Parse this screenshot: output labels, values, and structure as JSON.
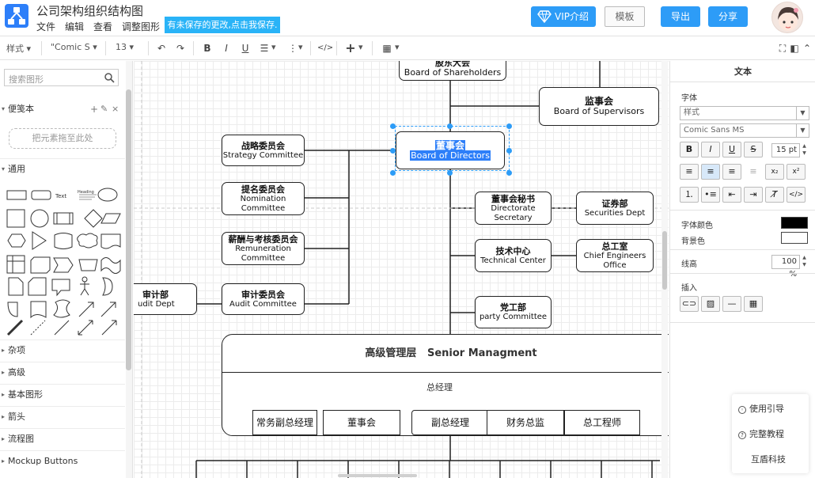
{
  "header": {
    "title": "公司架构组织结构图",
    "menu": [
      "文件",
      "编辑",
      "查看",
      "调整图形"
    ],
    "save_banner": "有未保存的更改,点击我保存.",
    "vip_label": "VIP介绍",
    "template_label": "模板",
    "export_label": "导出",
    "share_label": "分享"
  },
  "toolbar": {
    "style_label": "样式",
    "font_label": "\"Comic S",
    "size_label": "13"
  },
  "sidebar": {
    "search_placeholder": "搜索图形",
    "scratchpad_label": "便笺本",
    "drop_hint": "把元素拖至此处",
    "general_label": "通用",
    "shape_text_label": "Text",
    "heading_label": "Heading",
    "sections": [
      "杂项",
      "高级",
      "基本图形",
      "箭头",
      "流程图",
      "Mockup Buttons"
    ]
  },
  "canvas": {
    "nodes": {
      "shareholders": {
        "cn": "股东大会",
        "en": "Board of Shareholders"
      },
      "supervisors": {
        "cn": "监事会",
        "en": "Board of Supervisors"
      },
      "directors": {
        "cn": "董事会",
        "en": "Board of Directors"
      },
      "strategy": {
        "cn": "战略委员会",
        "en": "Strategy Committee"
      },
      "nomination": {
        "cn": "提名委员会",
        "en1": "Nomination",
        "en2": "Committee"
      },
      "remuneration": {
        "cn": "薪酬与考核委员会",
        "en1": "Remuneration",
        "en2": "Committee"
      },
      "audit_committee": {
        "cn": "审计委员会",
        "en": "Audit Committee"
      },
      "audit_dept": {
        "cn": "审计部",
        "en": "udit Dept"
      },
      "secretary": {
        "cn": "董事会秘书",
        "en1": "Directorate",
        "en2": "Secretary"
      },
      "securities": {
        "cn": "证券部",
        "en": "Securities Dept"
      },
      "technical": {
        "cn": "技术中心",
        "en": "Technical Center"
      },
      "engineers": {
        "cn": "总工室",
        "en1": "Chief Engineers",
        "en2": "Office"
      },
      "party": {
        "cn": "党工部",
        "en": "party Committee"
      },
      "senior_title": "高级管理层   Senior Managment",
      "gm": "总经理",
      "senior_items": [
        "常务副总经理",
        "董事会",
        "副总经理",
        "财务总监",
        "总工程师"
      ]
    }
  },
  "right_panel": {
    "tab_title": "文本",
    "font_section": "字体",
    "style_placeholder": "样式",
    "font_name": "Comic Sans MS",
    "font_size": "15 pt",
    "font_color_label": "字体颜色",
    "bg_color_label": "背景色",
    "line_height_label": "线高",
    "line_height_value": "100 %",
    "insert_label": "插入"
  },
  "help": {
    "items": [
      "使用引导",
      "完整教程",
      "互盾科技"
    ]
  },
  "colors": {
    "accent": "#2d9cf7",
    "banner": "#29b3f7",
    "selection": "#2d7ff9"
  }
}
